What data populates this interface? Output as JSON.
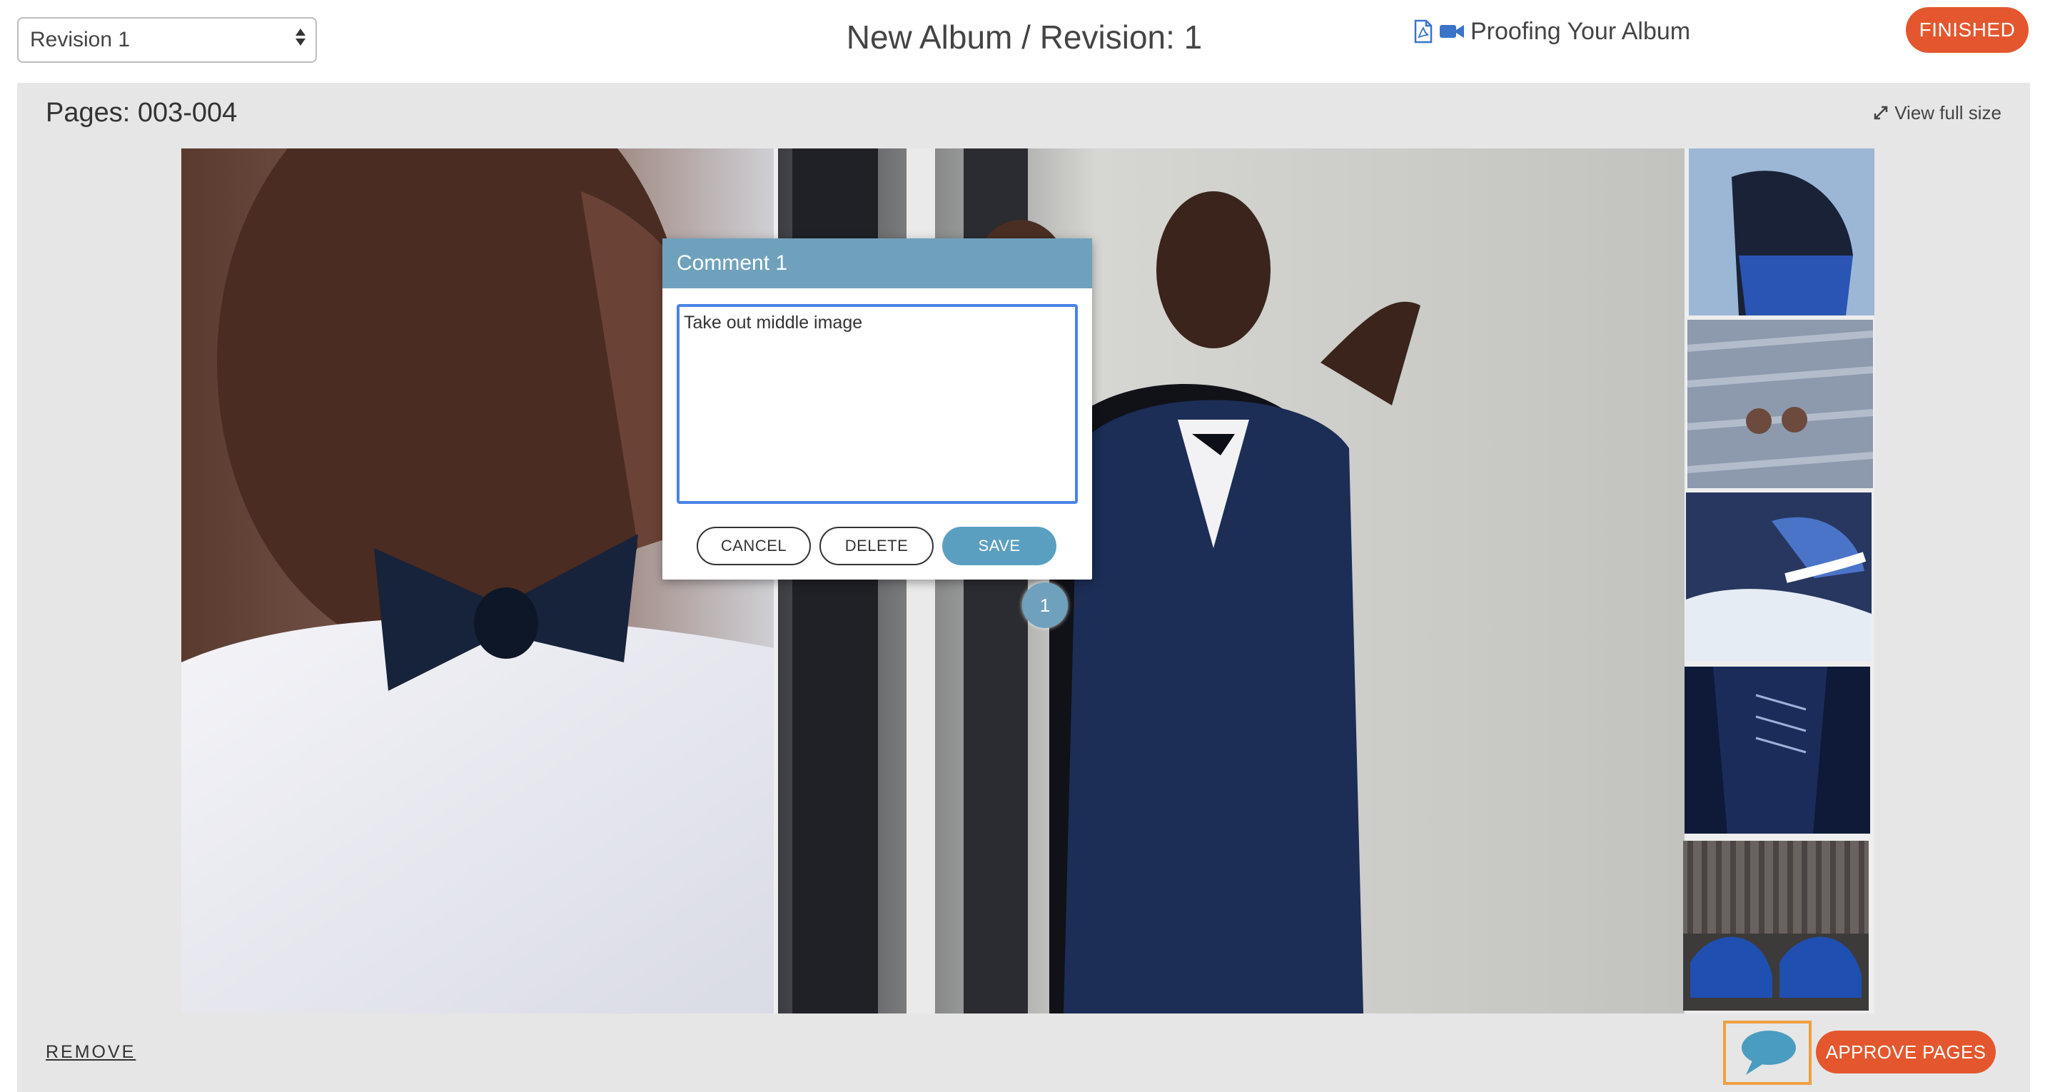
{
  "header": {
    "revision_select": {
      "value": "Revision 1"
    },
    "title": "New Album / Revision: 1",
    "proofing_label": "Proofing Your Album",
    "finished_label": "FINISHED"
  },
  "panel": {
    "pages_label": "Pages: 003-004",
    "view_full_label": "View full size"
  },
  "comment_dialog": {
    "title": "Comment 1",
    "text": "Take out middle image",
    "cancel_label": "CANCEL",
    "delete_label": "DELETE",
    "save_label": "SAVE"
  },
  "comment_marker": {
    "number": "1"
  },
  "footer": {
    "remove_label": "REMOVE",
    "approve_label": "APPROVE PAGES"
  },
  "colors": {
    "accent_orange": "#e4572e",
    "dialog_header": "#6fa1bd",
    "save_button": "#5b9fc0",
    "panel_bg": "#e6e6e6",
    "focus_border": "#4a83e8",
    "toggle_highlight": "#f0a040"
  },
  "icons": {
    "pdf": "pdf-file-icon",
    "video": "video-camera-icon",
    "expand": "expand-arrows-icon",
    "comment": "speech-bubble-icon"
  }
}
